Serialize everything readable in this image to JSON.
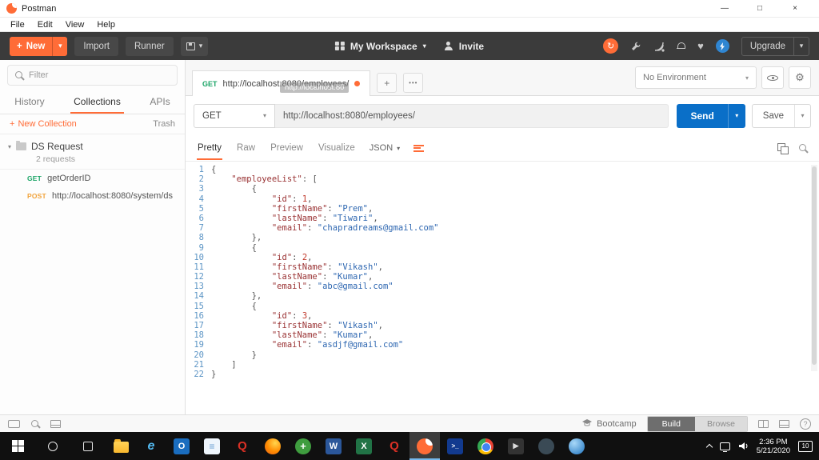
{
  "window": {
    "title": "Postman",
    "menu": [
      "File",
      "Edit",
      "View",
      "Help"
    ],
    "controls": {
      "minimize": "—",
      "maximize": "□",
      "close": "×"
    }
  },
  "toolbar": {
    "new": "New",
    "import": "Import",
    "runner": "Runner",
    "workspace": "My Workspace",
    "invite": "Invite",
    "upgrade": "Upgrade"
  },
  "sidebar": {
    "filter_placeholder": "Filter",
    "tabs": [
      "History",
      "Collections",
      "APIs"
    ],
    "active_tab": "Collections",
    "new_collection": "New Collection",
    "trash": "Trash",
    "collection": {
      "name": "DS Request",
      "count": "2 requests"
    },
    "requests": [
      {
        "method": "GET",
        "label": "getOrderID"
      },
      {
        "method": "POST",
        "label": "http://localhost:8080/system/ds"
      }
    ]
  },
  "request": {
    "tab_method": "GET",
    "tab_url": "http://localhost:8080/employees/",
    "tab_tooltip": "http://localhost:80",
    "method": "GET",
    "url": "http://localhost:8080/employees/",
    "send": "Send",
    "save": "Save",
    "environment": "No Environment"
  },
  "response": {
    "view_tabs": [
      "Pretty",
      "Raw",
      "Preview",
      "Visualize"
    ],
    "active_view": "Pretty",
    "format": "JSON",
    "body_lines": [
      "{",
      "    \"employeeList\": [",
      "        {",
      "            \"id\": 1,",
      "            \"firstName\": \"Prem\",",
      "            \"lastName\": \"Tiwari\",",
      "            \"email\": \"chapradreams@gmail.com\"",
      "        },",
      "        {",
      "            \"id\": 2,",
      "            \"firstName\": \"Vikash\",",
      "            \"lastName\": \"Kumar\",",
      "            \"email\": \"abc@gmail.com\"",
      "        },",
      "        {",
      "            \"id\": 3,",
      "            \"firstName\": \"Vikash\",",
      "            \"lastName\": \"Kumar\",",
      "            \"email\": \"asdjf@gmail.com\"",
      "        }",
      "    ]",
      "}"
    ]
  },
  "statusbar": {
    "bootcamp": "Bootcamp",
    "build": "Build",
    "browse": "Browse"
  },
  "taskbar": {
    "time": "2:36 PM",
    "date": "5/21/2020",
    "badge": "10",
    "apps": [
      {
        "name": "file-explorer",
        "shape": "folder"
      },
      {
        "name": "internet-explorer",
        "glyph": "e",
        "fg": "#53b9f0",
        "fs": "16px",
        "it": true
      },
      {
        "name": "outlook",
        "glyph": "O",
        "bg": "#1a6dbf",
        "fg": "#ffffff",
        "fs": "11px"
      },
      {
        "name": "notepad",
        "glyph": "≡",
        "bg": "#eef5fc",
        "fg": "#6b9fd2",
        "fs": "12px"
      },
      {
        "name": "red-q-app",
        "glyph": "Q",
        "fg": "#d93025",
        "fs": "15px"
      },
      {
        "name": "firefox",
        "shape": "circle",
        "bg": "radial-gradient(circle at 65% 30%, #ffd54d, #ff8a00 55%, #e3611f)"
      },
      {
        "name": "green-app",
        "shape": "circle",
        "glyph": "+",
        "bg": "#3f9d3f",
        "fg": "#ffffff",
        "fs": "13px"
      },
      {
        "name": "word",
        "glyph": "W",
        "bg": "#2b579a",
        "fg": "#ffffff",
        "fs": "11px"
      },
      {
        "name": "excel",
        "glyph": "X",
        "bg": "#217346",
        "fg": "#ffffff",
        "fs": "11px"
      },
      {
        "name": "red-q-app-2",
        "glyph": "Q",
        "fg": "#d93025",
        "fs": "15px"
      },
      {
        "name": "postman",
        "shape": "postman",
        "active": true
      },
      {
        "name": "powershell",
        "glyph": ">_",
        "bg": "#123a8f",
        "fg": "#ffffff",
        "fs": "8px"
      },
      {
        "name": "chrome",
        "shape": "chrome"
      },
      {
        "name": "media-app",
        "glyph": "▶",
        "bg": "#333333",
        "fg": "#dddddd",
        "fs": "9px"
      },
      {
        "name": "steam",
        "shape": "circle",
        "bg": "#3a4a55"
      },
      {
        "name": "globe-app",
        "shape": "circle",
        "bg": "radial-gradient(circle at 35% 30%, #a8d8f8, #1f74c0)"
      }
    ]
  },
  "icons": {
    "plus": "+",
    "caret": "▾",
    "ellipsis": "•••",
    "gear": "⚙",
    "heart": "♥",
    "sync": "↻",
    "question": "?"
  },
  "colors": {
    "accent_orange": "#ff6c37",
    "send_blue": "#0a6fc8",
    "get_green": "#1ca567",
    "post_orange": "#f1a33c"
  }
}
